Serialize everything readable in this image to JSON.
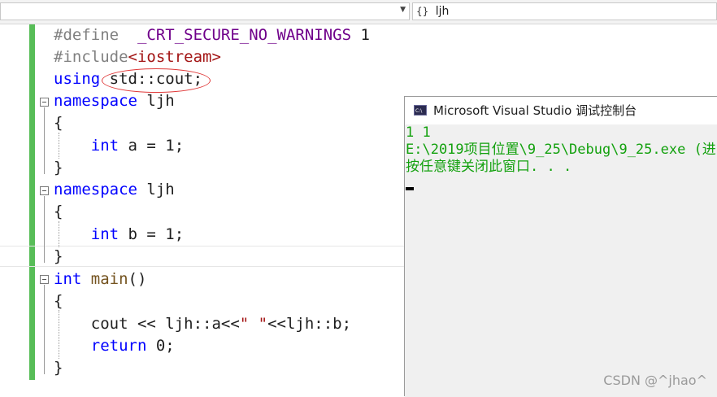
{
  "toolbar": {
    "left_combo_value": "",
    "right_combo_icon": "{}",
    "right_combo_value": "ljh"
  },
  "code": {
    "lines": [
      "#define  _CRT_SECURE_NO_WARNINGS 1",
      "#include<iostream>",
      "using std::cout;",
      "namespace ljh",
      "{",
      "int a = 1;",
      "}",
      "namespace ljh",
      "{",
      "int b = 1;",
      "}",
      "int main()",
      "{",
      "cout << ljh::a<<\" \"<<ljh::b;",
      "return 0;",
      "}"
    ]
  },
  "console": {
    "title": "Microsoft Visual Studio 调试控制台",
    "output_lines": [
      "1 1",
      "E:\\2019项目位置\\9_25\\Debug\\9_25.exe (进",
      "按任意键关闭此窗口. . ."
    ]
  },
  "watermark": "CSDN @^jhao^",
  "colors": {
    "keyword": "#0000ff",
    "preprocessor": "#808080",
    "macro": "#6f008a",
    "string": "#a31515",
    "console_text": "#13a10e",
    "change_bar": "#57bd57",
    "annotation": "#e03a3a"
  }
}
